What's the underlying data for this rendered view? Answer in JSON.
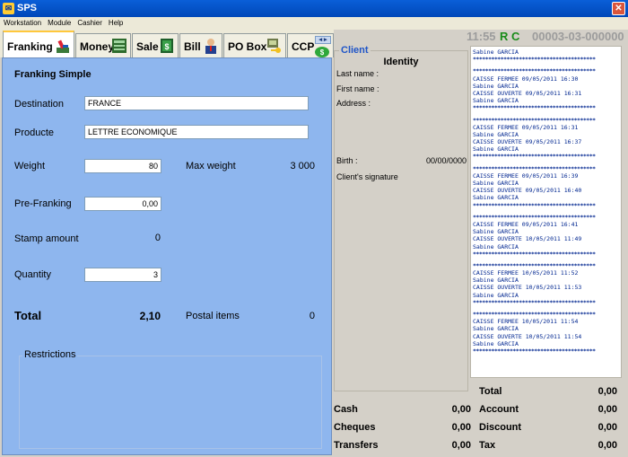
{
  "window": {
    "title": "SPS"
  },
  "menu": [
    "Workstation",
    "Module",
    "Cashier",
    "Help"
  ],
  "tabs": [
    {
      "label": "Franking",
      "icon": "franking-machine-icon",
      "active": true
    },
    {
      "label": "Money",
      "icon": "money-order-icon"
    },
    {
      "label": "Sale",
      "icon": "stamp-sale-icon"
    },
    {
      "label": "Bill",
      "icon": "person-bill-icon"
    },
    {
      "label": "PO Box",
      "icon": "po-box-key-icon"
    },
    {
      "label": "CCP",
      "icon": "ccp-coin-icon"
    }
  ],
  "status": {
    "time": "11:55",
    "flags": "R C",
    "code": "00003-03-000000"
  },
  "franking": {
    "section_title": "Franking Simple",
    "destination_label": "Destination",
    "destination_value": "FRANCE",
    "product_label": "Producte",
    "product_value": "LETTRE ECONOMIQUE",
    "weight_label": "Weight",
    "weight_value": "80",
    "max_weight_label": "Max weight",
    "max_weight_value": "3 000",
    "prefranking_label": "Pre-Franking",
    "prefranking_value": "0,00",
    "stamp_amount_label": "Stamp amount",
    "stamp_amount_value": "0",
    "quantity_label": "Quantity",
    "quantity_value": "3",
    "total_label": "Total",
    "total_value": "2,10",
    "postal_items_label": "Postal items",
    "postal_items_value": "0",
    "restrictions_label": "Restrictions"
  },
  "client": {
    "legend": "Client",
    "identity_title": "Identity",
    "last_name_label": "Last name :",
    "first_name_label": "First name :",
    "address_label": "Address :",
    "birth_label": "Birth :",
    "birth_value": "00/00/0000",
    "signature_label": "Client's signature"
  },
  "receipt": {
    "separator": "****************************************",
    "first_line": "Sabine GARCIA",
    "blocks": [
      [
        "CAISSE FERMEE 09/05/2011 16:30",
        "Sabine GARCIA",
        "CAISSE OUVERTE 09/05/2011 16:31",
        "Sabine GARCIA"
      ],
      [
        "CAISSE FERMEE 09/05/2011 16:31",
        "Sabine GARCIA",
        "CAISSE OUVERTE 09/05/2011 16:37",
        "Sabine GARCIA"
      ],
      [
        "CAISSE FERMEE 09/05/2011 16:39",
        "Sabine GARCIA",
        "CAISSE OUVERTE 09/05/2011 16:40",
        "Sabine GARCIA"
      ],
      [
        "CAISSE FERMEE 09/05/2011 16:41",
        "Sabine GARCIA",
        "CAISSE OUVERTE 10/05/2011 11:49",
        "Sabine GARCIA"
      ],
      [
        "CAISSE FERMEE 10/05/2011 11:52",
        "Sabine GARCIA",
        "CAISSE OUVERTE 10/05/2011 11:53",
        "Sabine GARCIA"
      ],
      [
        "CAISSE FERMEE 10/05/2011 11:54",
        "Sabine GARCIA",
        "CAISSE OUVERTE 10/05/2011 11:54",
        "Sabine GARCIA"
      ]
    ]
  },
  "payments": {
    "cash_label": "Cash",
    "cash_value": "0,00",
    "cheques_label": "Cheques",
    "cheques_value": "0,00",
    "transfers_label": "Transfers",
    "transfers_value": "0,00"
  },
  "summary": {
    "total_label": "Total",
    "total_value": "0,00",
    "account_label": "Account",
    "account_value": "0,00",
    "discount_label": "Discount",
    "discount_value": "0,00",
    "tax_label": "Tax",
    "tax_value": "0,00"
  }
}
